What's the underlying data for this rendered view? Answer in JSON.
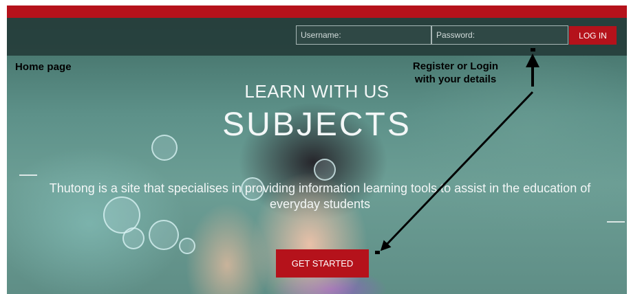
{
  "header": {
    "username_placeholder": "Username:",
    "password_placeholder": "Password:",
    "login_label": "LOG IN"
  },
  "annotations": {
    "home": "Home page",
    "register_line1": "Register or Login",
    "register_line2": "with your details"
  },
  "hero": {
    "subtitle": "LEARN WITH US",
    "title": "SUBJECTS",
    "description": "Thutong is a site that specialises in providing information learning tools to assist  in the education of everyday students",
    "cta_label": "GET STARTED"
  },
  "colors": {
    "brand_red": "#b5121b",
    "nav_bg": "#233a38"
  }
}
